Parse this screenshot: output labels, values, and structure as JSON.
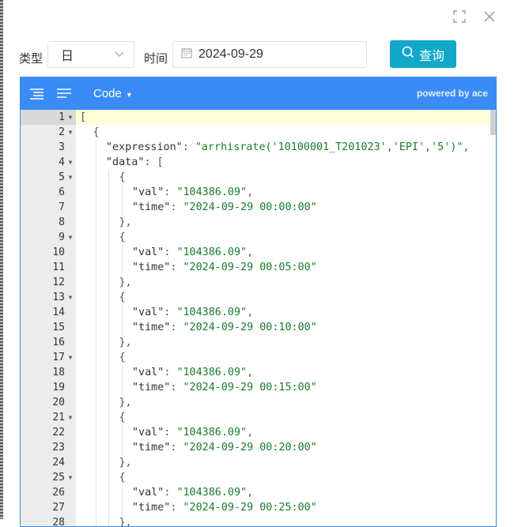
{
  "filter": {
    "type_label": "类型",
    "type_value": "日",
    "time_label": "时间",
    "date_value": "2024-09-29",
    "query_label": "查询"
  },
  "editor": {
    "mode_label": "Code",
    "powered": "powered by ace",
    "lines": [
      {
        "n": "1",
        "fold": true,
        "indent": 0,
        "parts": [
          [
            "p",
            "["
          ]
        ]
      },
      {
        "n": "2",
        "fold": true,
        "indent": 1,
        "parts": [
          [
            "p",
            "{"
          ]
        ]
      },
      {
        "n": "3",
        "fold": false,
        "indent": 2,
        "parts": [
          [
            "k",
            "\"expression\""
          ],
          [
            "p",
            ": "
          ],
          [
            "s",
            "\"arrhisrate('10100001_T201023','EPI','5')\""
          ],
          [
            "p",
            ","
          ]
        ]
      },
      {
        "n": "4",
        "fold": true,
        "indent": 2,
        "parts": [
          [
            "k",
            "\"data\""
          ],
          [
            "p",
            ": ["
          ]
        ]
      },
      {
        "n": "5",
        "fold": true,
        "indent": 3,
        "parts": [
          [
            "p",
            "{"
          ]
        ]
      },
      {
        "n": "6",
        "fold": false,
        "indent": 4,
        "parts": [
          [
            "k",
            "\"val\""
          ],
          [
            "p",
            ": "
          ],
          [
            "s",
            "\"104386.09\""
          ],
          [
            "p",
            ","
          ]
        ]
      },
      {
        "n": "7",
        "fold": false,
        "indent": 4,
        "parts": [
          [
            "k",
            "\"time\""
          ],
          [
            "p",
            ": "
          ],
          [
            "s",
            "\"2024-09-29 00:00:00\""
          ]
        ]
      },
      {
        "n": "8",
        "fold": false,
        "indent": 3,
        "parts": [
          [
            "p",
            "},"
          ]
        ]
      },
      {
        "n": "9",
        "fold": true,
        "indent": 3,
        "parts": [
          [
            "p",
            "{"
          ]
        ]
      },
      {
        "n": "10",
        "fold": false,
        "indent": 4,
        "parts": [
          [
            "k",
            "\"val\""
          ],
          [
            "p",
            ": "
          ],
          [
            "s",
            "\"104386.09\""
          ],
          [
            "p",
            ","
          ]
        ]
      },
      {
        "n": "11",
        "fold": false,
        "indent": 4,
        "parts": [
          [
            "k",
            "\"time\""
          ],
          [
            "p",
            ": "
          ],
          [
            "s",
            "\"2024-09-29 00:05:00\""
          ]
        ]
      },
      {
        "n": "12",
        "fold": false,
        "indent": 3,
        "parts": [
          [
            "p",
            "},"
          ]
        ]
      },
      {
        "n": "13",
        "fold": true,
        "indent": 3,
        "parts": [
          [
            "p",
            "{"
          ]
        ]
      },
      {
        "n": "14",
        "fold": false,
        "indent": 4,
        "parts": [
          [
            "k",
            "\"val\""
          ],
          [
            "p",
            ": "
          ],
          [
            "s",
            "\"104386.09\""
          ],
          [
            "p",
            ","
          ]
        ]
      },
      {
        "n": "15",
        "fold": false,
        "indent": 4,
        "parts": [
          [
            "k",
            "\"time\""
          ],
          [
            "p",
            ": "
          ],
          [
            "s",
            "\"2024-09-29 00:10:00\""
          ]
        ]
      },
      {
        "n": "16",
        "fold": false,
        "indent": 3,
        "parts": [
          [
            "p",
            "},"
          ]
        ]
      },
      {
        "n": "17",
        "fold": true,
        "indent": 3,
        "parts": [
          [
            "p",
            "{"
          ]
        ]
      },
      {
        "n": "18",
        "fold": false,
        "indent": 4,
        "parts": [
          [
            "k",
            "\"val\""
          ],
          [
            "p",
            ": "
          ],
          [
            "s",
            "\"104386.09\""
          ],
          [
            "p",
            ","
          ]
        ]
      },
      {
        "n": "19",
        "fold": false,
        "indent": 4,
        "parts": [
          [
            "k",
            "\"time\""
          ],
          [
            "p",
            ": "
          ],
          [
            "s",
            "\"2024-09-29 00:15:00\""
          ]
        ]
      },
      {
        "n": "20",
        "fold": false,
        "indent": 3,
        "parts": [
          [
            "p",
            "},"
          ]
        ]
      },
      {
        "n": "21",
        "fold": true,
        "indent": 3,
        "parts": [
          [
            "p",
            "{"
          ]
        ]
      },
      {
        "n": "22",
        "fold": false,
        "indent": 4,
        "parts": [
          [
            "k",
            "\"val\""
          ],
          [
            "p",
            ": "
          ],
          [
            "s",
            "\"104386.09\""
          ],
          [
            "p",
            ","
          ]
        ]
      },
      {
        "n": "23",
        "fold": false,
        "indent": 4,
        "parts": [
          [
            "k",
            "\"time\""
          ],
          [
            "p",
            ": "
          ],
          [
            "s",
            "\"2024-09-29 00:20:00\""
          ]
        ]
      },
      {
        "n": "24",
        "fold": false,
        "indent": 3,
        "parts": [
          [
            "p",
            "},"
          ]
        ]
      },
      {
        "n": "25",
        "fold": true,
        "indent": 3,
        "parts": [
          [
            "p",
            "{"
          ]
        ]
      },
      {
        "n": "26",
        "fold": false,
        "indent": 4,
        "parts": [
          [
            "k",
            "\"val\""
          ],
          [
            "p",
            ": "
          ],
          [
            "s",
            "\"104386.09\""
          ],
          [
            "p",
            ","
          ]
        ]
      },
      {
        "n": "27",
        "fold": false,
        "indent": 4,
        "parts": [
          [
            "k",
            "\"time\""
          ],
          [
            "p",
            ": "
          ],
          [
            "s",
            "\"2024-09-29 00:25:00\""
          ]
        ]
      },
      {
        "n": "28",
        "fold": false,
        "indent": 3,
        "parts": [
          [
            "p",
            "},"
          ]
        ]
      }
    ]
  }
}
